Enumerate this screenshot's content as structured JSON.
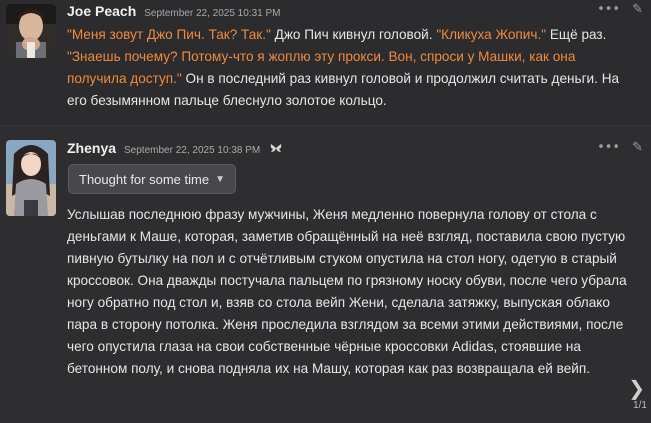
{
  "messages": [
    {
      "name": "Joe Peach",
      "time": "September 22, 2025 10:31 PM",
      "segments": [
        {
          "kind": "quote",
          "text": "\"Меня зовут Джо Пич. Так? Так.\""
        },
        {
          "kind": "plain",
          "text": " Джо Пич кивнул головой. "
        },
        {
          "kind": "quote",
          "text": "\"Кликуха Жопич.\""
        },
        {
          "kind": "plain",
          "text": " Ещё раз. "
        },
        {
          "kind": "quote",
          "text": "\"Знаешь почему? Потому-что я жоплю эту прокси. Вон, спроси у Машки, как она получила доступ.\""
        },
        {
          "kind": "plain",
          "text": " Он в последний раз кивнул головой и продолжил считать деньги. На его безымянном пальце блеснуло золотое кольцо."
        }
      ]
    },
    {
      "name": "Zhenya",
      "time": "September 22, 2025 10:38 PM",
      "thought_label": "Thought for some time",
      "segments": [
        {
          "kind": "plain",
          "text": "Услышав последнюю фразу мужчины, Женя медленно повернула голову от стола с деньгами к Маше, которая, заметив обращённый на неё взгляд, поставила свою пустую пивную бутылку на пол и с отчётливым стуком опустила на стол ногу, одетую в старый кроссовок. Она дважды постучала пальцем по грязному носку обуви, после чего убрала ногу обратно под стол и, взяв со стола вейп Жени, сделала затяжку, выпуская облако пара в сторону потолка. Женя проследила взглядом за всеми этими действиями, после чего опустила глаза на свои собственные чёрные кроссовки Adidas, стоявшие на бетонном полу, и снова подняла их на Машу, которая как раз возвращала ей вейп."
        }
      ],
      "swipe_counter": "1/1"
    }
  ],
  "icons": {
    "more": "ellipsis-icon",
    "edit": "pencil-icon",
    "swipe": "chevron-right-icon",
    "bot": "butterfly-icon"
  },
  "colors": {
    "quote": "#f08a3c",
    "background": "#2b2b2e",
    "text": "#e6e6e6"
  }
}
